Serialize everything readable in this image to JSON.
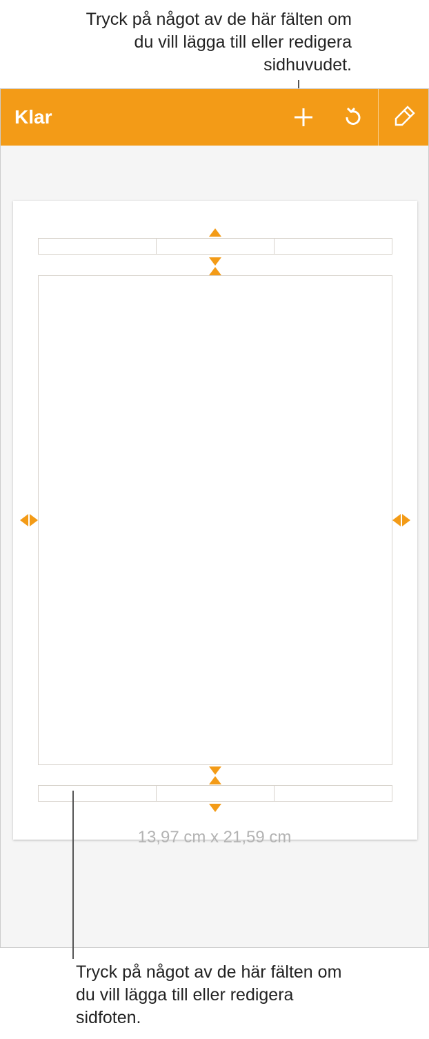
{
  "callouts": {
    "top": "Tryck på något av de här fälten om du vill lägga till eller redigera sidhuvudet.",
    "bottom": "Tryck på något av de här fälten om du vill lägga till eller redigera sidfoten."
  },
  "toolbar": {
    "done_label": "Klar",
    "icons": {
      "add": "plus-icon",
      "undo": "undo-icon",
      "format": "format-brush-icon"
    }
  },
  "document": {
    "dimensions_label": "13,97 cm x 21,59 cm",
    "header_fields": [
      "",
      "",
      ""
    ],
    "footer_fields": [
      "",
      "",
      ""
    ]
  }
}
